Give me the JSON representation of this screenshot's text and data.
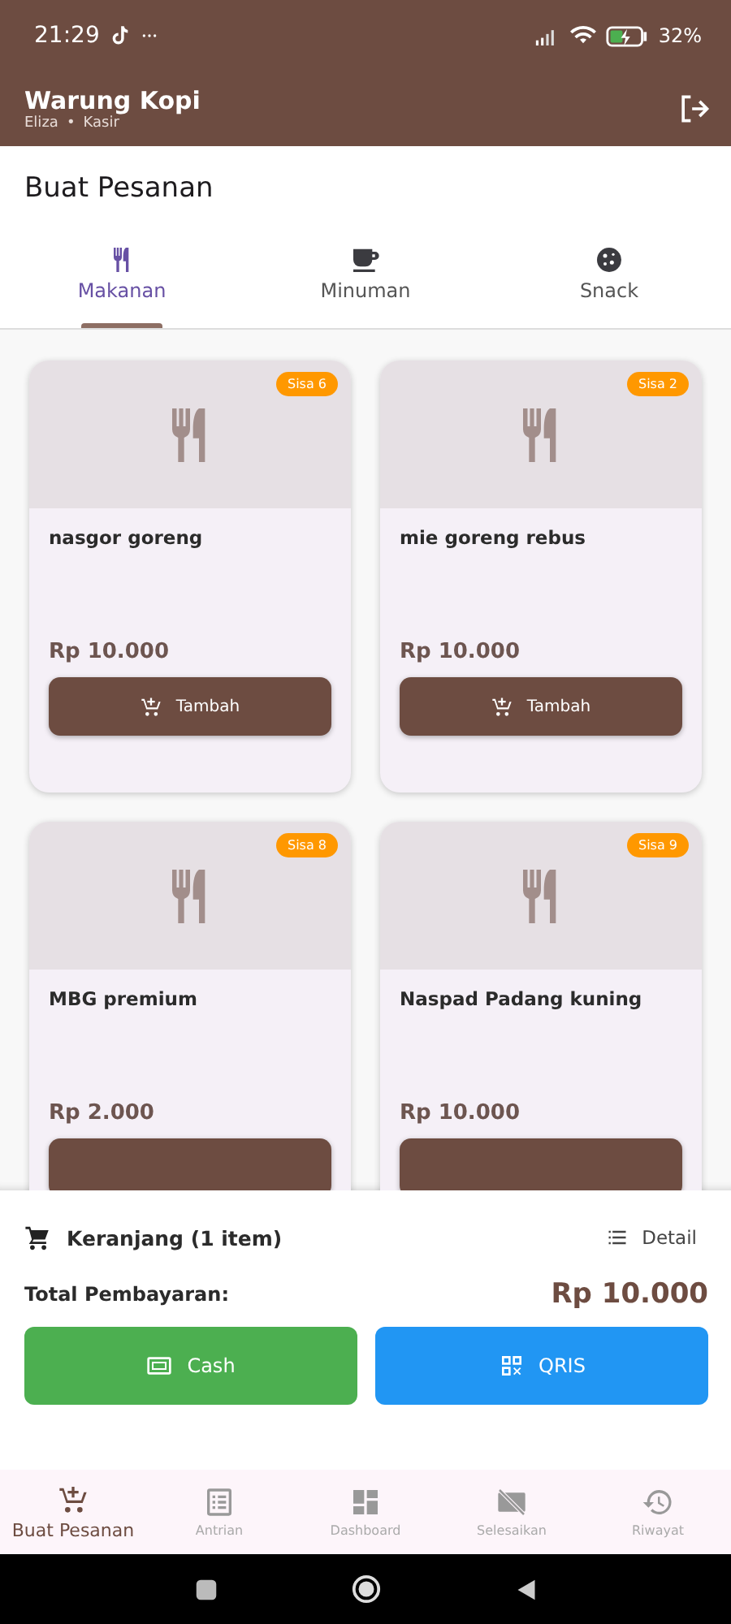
{
  "status_bar": {
    "time": "21:29",
    "battery": "32%"
  },
  "app_bar": {
    "title": "Warung Kopi",
    "user": "Eliza",
    "separator": "•",
    "role": "Kasir"
  },
  "page_title": "Buat Pesanan",
  "tabs": [
    {
      "label": "Makanan",
      "kind": "food",
      "selected": true
    },
    {
      "label": "Minuman",
      "kind": "drink",
      "selected": false
    },
    {
      "label": "Snack",
      "kind": "snack",
      "selected": false
    }
  ],
  "products": [
    {
      "name": "nasgor goreng",
      "stock": "Sisa 6",
      "price": "Rp 10.000",
      "button": "Tambah"
    },
    {
      "name": "mie goreng rebus",
      "stock": "Sisa 2",
      "price": "Rp 10.000",
      "button": "Tambah"
    },
    {
      "name": "MBG premium",
      "stock": "Sisa 8",
      "price": "Rp 2.000"
    },
    {
      "name": "Naspad Padang kuning",
      "stock": "Sisa 9",
      "price": "Rp 10.000"
    }
  ],
  "cart": {
    "label": "Keranjang (1 item)",
    "detail_button": "Detail",
    "total_label": "Total Pembayaran:",
    "total": "Rp 10.000"
  },
  "payment_buttons": [
    {
      "label": "Cash",
      "kind": "cash"
    },
    {
      "label": "QRIS",
      "kind": "qris"
    }
  ],
  "bottom_nav": [
    {
      "label": "Buat Pesanan",
      "kind": "order",
      "selected": true
    },
    {
      "label": "Antrian",
      "kind": "queue",
      "selected": false
    },
    {
      "label": "Dashboard",
      "kind": "dashboard",
      "selected": false
    },
    {
      "label": "Selesaikan",
      "kind": "finish",
      "selected": false
    },
    {
      "label": "Riwayat",
      "kind": "history",
      "selected": false
    }
  ]
}
